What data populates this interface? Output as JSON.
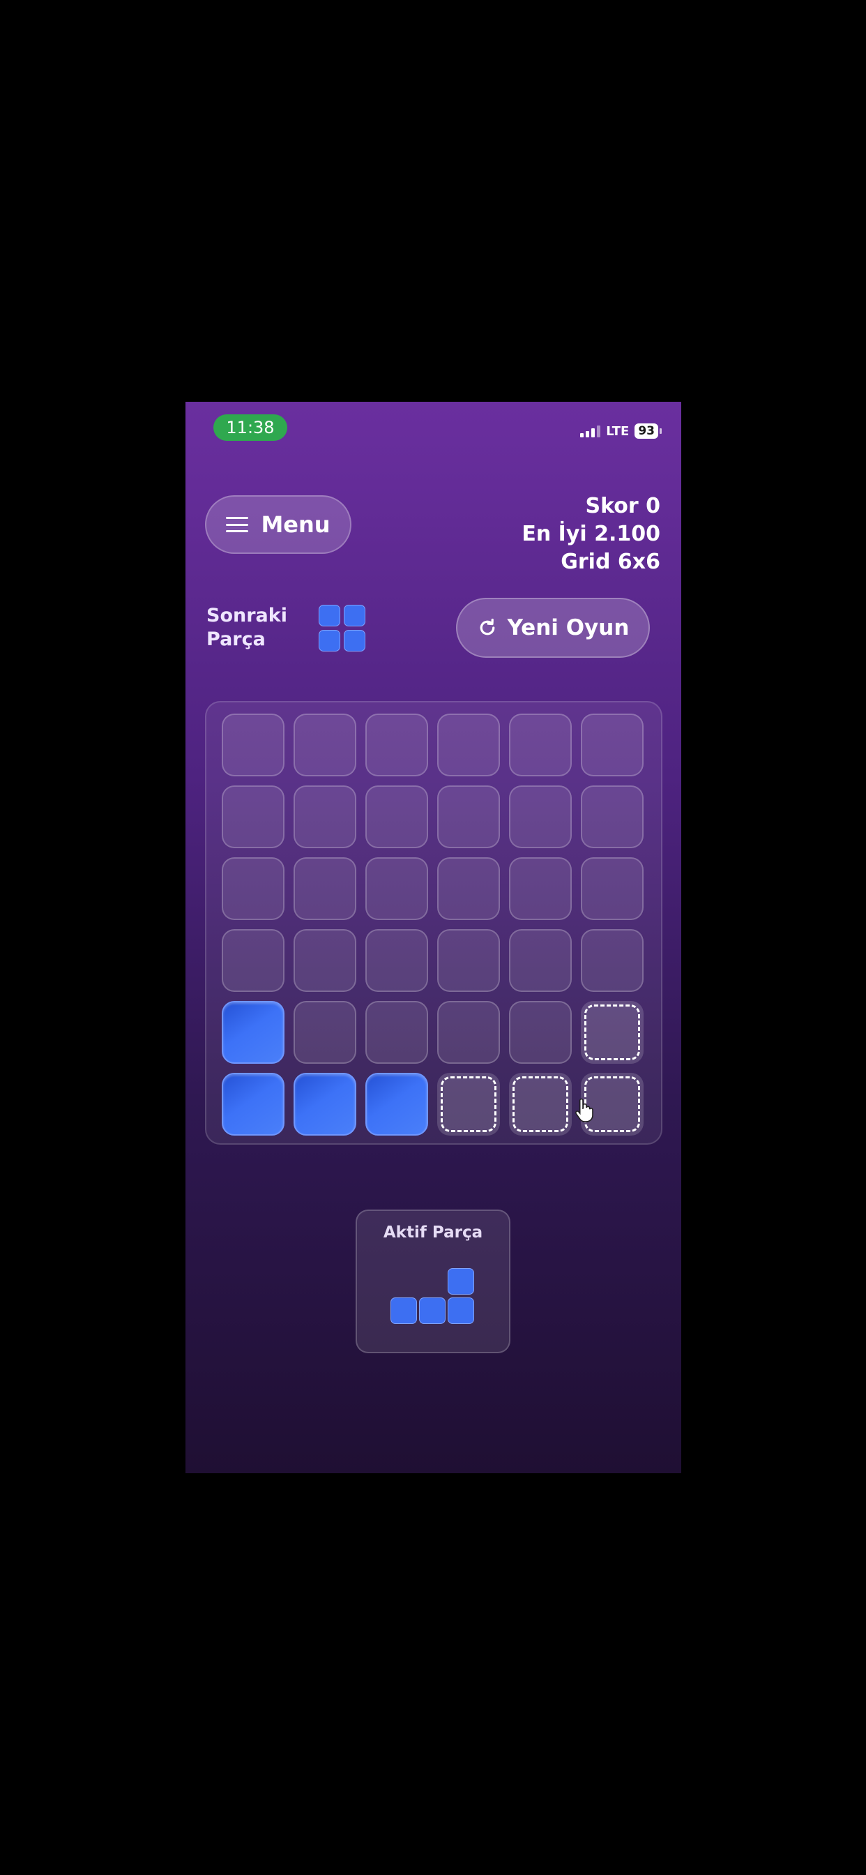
{
  "status_bar": {
    "time": "11:38",
    "network": "LTE",
    "battery": "93"
  },
  "header": {
    "menu_label": "Menu",
    "score_text": "Skor 0",
    "best_text": "En İyi 2.100",
    "grid_text": "Grid 6x6"
  },
  "next_piece": {
    "label_line1": "Sonraki",
    "label_line2": "Parça"
  },
  "new_game_label": "Yeni Oyun",
  "board": {
    "rows": 6,
    "cols": 6,
    "filled_cells": [
      [
        4,
        0
      ],
      [
        5,
        0
      ],
      [
        5,
        1
      ],
      [
        5,
        2
      ]
    ],
    "ghost_cells": [
      [
        4,
        5
      ],
      [
        5,
        3
      ],
      [
        5,
        4
      ],
      [
        5,
        5
      ]
    ]
  },
  "active_piece": {
    "title": "Aktif Parça"
  },
  "colors": {
    "block": "#3d6ff2",
    "time_pill": "#2fa84f",
    "background_top": "#6a2f9f",
    "background_bottom": "#1f0f33"
  }
}
